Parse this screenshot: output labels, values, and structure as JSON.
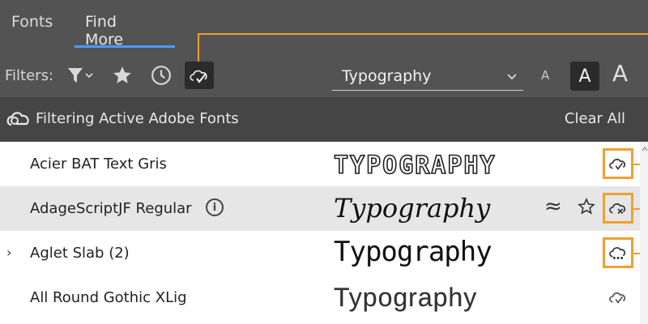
{
  "tabs": [
    {
      "label": "Fonts",
      "active": false
    },
    {
      "label": "Find More",
      "active": true
    }
  ],
  "filters": {
    "label": "Filters:",
    "icons": [
      "funnel-icon",
      "star-icon",
      "clock-icon",
      "active-cloud-check-icon"
    ]
  },
  "preview": {
    "value": "Typography",
    "size_small": "A",
    "size_medium": "A",
    "size_large": "A"
  },
  "filter_bar": {
    "text": "Filtering Active Adobe Fonts",
    "clear_label": "Clear All"
  },
  "fonts": [
    {
      "name": "Acier BAT Text Gris",
      "sample": "TYPOGRAPHY",
      "status_icon": "cloud-check-icon",
      "highlighted": true
    },
    {
      "name": "AdageScriptJF Regular",
      "sample": "Typography",
      "status_icon": "cloud-remove-icon",
      "highlighted": true,
      "has_info": true,
      "has_similar": true,
      "has_favorite": true
    },
    {
      "name": "Aglet Slab (2)",
      "sample": "Typography",
      "status_icon": "cloud-partial-icon",
      "highlighted": true,
      "expandable": true,
      "expand_glyph": "›"
    },
    {
      "name": "All Round Gothic XLig",
      "sample": "Typography",
      "status_icon": "cloud-check-icon",
      "highlighted": false
    }
  ],
  "colors": {
    "panel": "#535353",
    "filter_bar": "#454545",
    "accent_tab": "#4b9cf5",
    "callout": "#f0a030",
    "row_alt": "#e6e6e6"
  }
}
